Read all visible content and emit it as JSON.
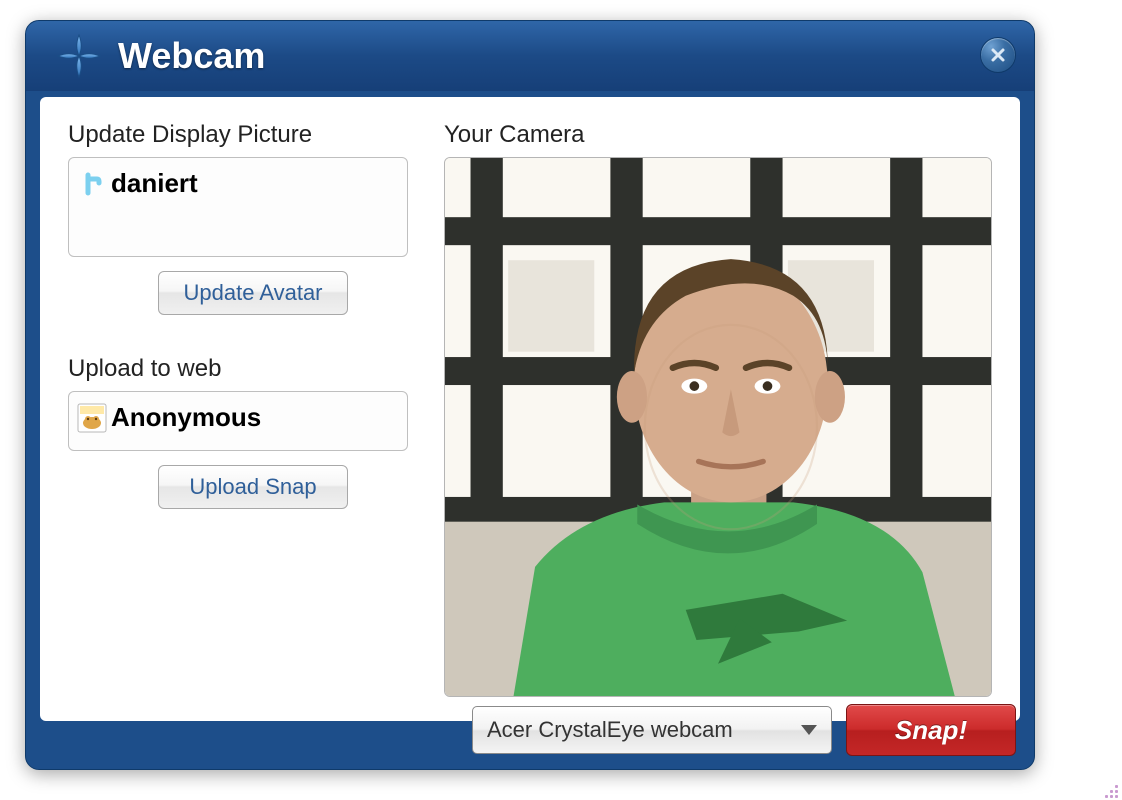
{
  "window": {
    "title": "Webcam"
  },
  "left": {
    "update_label": "Update Display Picture",
    "accounts": [
      {
        "service": "twitter",
        "username": "daniert"
      }
    ],
    "update_avatar_btn": "Update Avatar",
    "upload_label": "Upload to web",
    "upload_accounts": [
      {
        "service": "imgfrog",
        "username": "Anonymous"
      }
    ],
    "upload_snap_btn": "Upload Snap"
  },
  "right": {
    "camera_label": "Your Camera"
  },
  "bottom": {
    "camera_dropdown": {
      "selected": "Acer CrystalEye webcam"
    },
    "snap_btn": "Snap!"
  }
}
